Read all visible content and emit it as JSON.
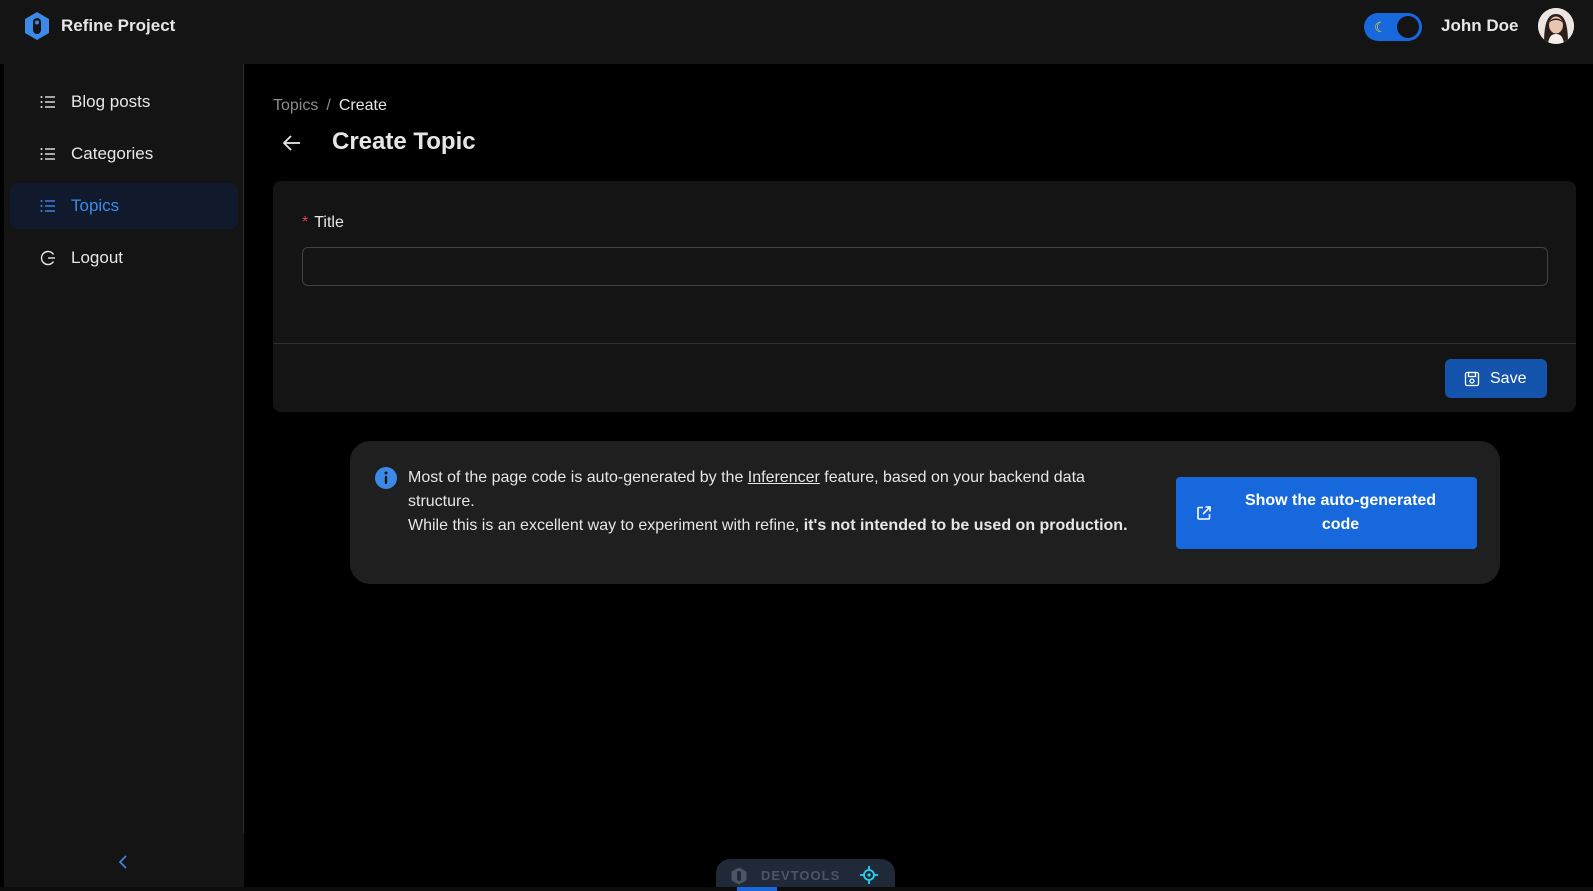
{
  "header": {
    "app_title": "Refine Project",
    "user_name": "John Doe",
    "theme_toggle_icon": "moon-icon"
  },
  "sidebar": {
    "items": [
      {
        "label": "Blog posts",
        "icon": "list-icon",
        "active": false
      },
      {
        "label": "Categories",
        "icon": "list-icon",
        "active": false
      },
      {
        "label": "Topics",
        "icon": "list-icon",
        "active": true
      },
      {
        "label": "Logout",
        "icon": "logout-icon",
        "active": false
      }
    ],
    "collapse_icon": "chevron-left-icon"
  },
  "breadcrumb": {
    "parent": "Topics",
    "separator": "/",
    "current": "Create"
  },
  "page": {
    "title": "Create Topic"
  },
  "form": {
    "title_label": "Title",
    "required_mark": "*",
    "title_value": "",
    "save_label": "Save"
  },
  "alert": {
    "text_part1": "Most of the page code is auto-generated by the ",
    "link_text": "Inferencer",
    "text_part2": " feature, based on your backend data structure.",
    "text_part3": "While this is an excellent way to experiment with refine, ",
    "bold_text": "it's not intended to be used on production.",
    "button_label": "Show the auto-generated code"
  },
  "devtools": {
    "label": "DEVTOOLS"
  },
  "colors": {
    "accent": "#1668dc",
    "active_menu_text": "#3c89e8",
    "required": "#dc4446"
  }
}
